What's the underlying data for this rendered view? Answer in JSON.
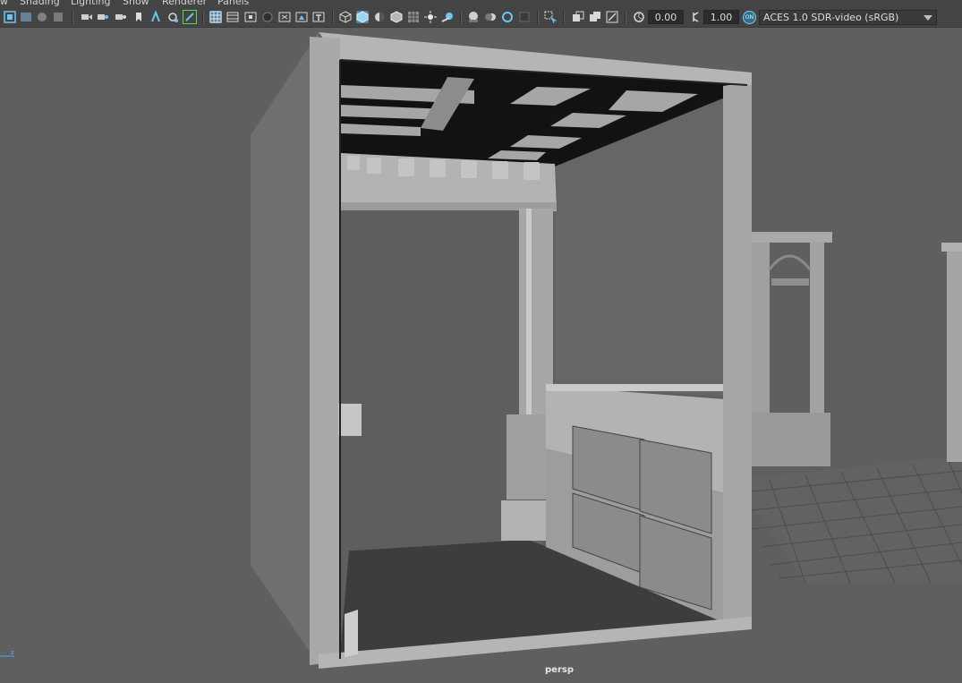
{
  "menubar": {
    "items": [
      {
        "label": "w",
        "name": "menu-view"
      },
      {
        "label": "Shading",
        "name": "menu-shading"
      },
      {
        "label": "Lighting",
        "name": "menu-lighting"
      },
      {
        "label": "Show",
        "name": "menu-show"
      },
      {
        "label": "Renderer",
        "name": "menu-renderer"
      },
      {
        "label": "Panels",
        "name": "menu-panels"
      }
    ]
  },
  "toolbar": {
    "exposure_value": "0.00",
    "gamma_value": "1.00",
    "color_management_badge": "ON",
    "color_space": "ACES 1.0 SDR-video (sRGB)"
  },
  "viewport": {
    "camera_label": "persp",
    "axis_label": "z"
  },
  "colors": {
    "background": "#5f5f5f",
    "toolbar": "#444444",
    "active_button": "#5285a6",
    "geometry_light": "#a7a7a7",
    "geometry_dark": "#3e3e3e"
  }
}
